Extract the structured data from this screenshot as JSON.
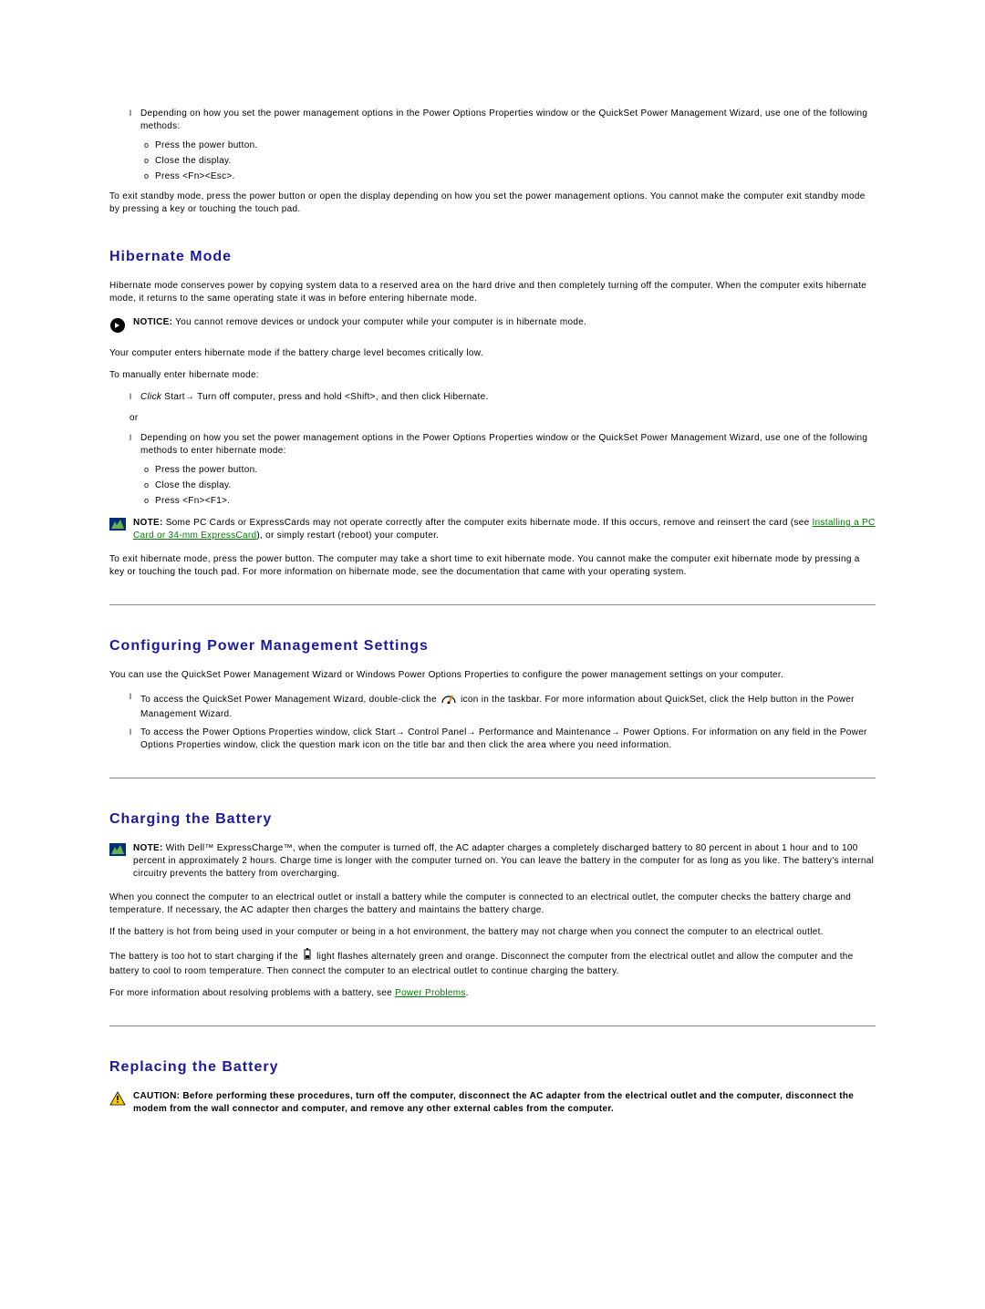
{
  "intro": {
    "li0": "Depending on how you set the power management options in the Power Options Properties window or the QuickSet Power Management Wizard, use one of the following methods:",
    "sub": [
      "Press the power button.",
      "Close the display.",
      "Press <Fn><Esc>."
    ],
    "exit": "To exit standby mode, press the power button or open the display depending on how you set the power management options. You cannot make the computer exit standby mode by pressing a key or touching the touch pad."
  },
  "hibernate": {
    "heading": "Hibernate Mode",
    "p1": "Hibernate mode conserves power by copying system data to a reserved area on the hard drive and then completely turning off the computer. When the computer exits hibernate mode, it returns to the same operating state it was in before entering hibernate mode.",
    "notice_label": "NOTICE:",
    "notice": "You cannot remove devices or undock your computer while your computer is in hibernate mode.",
    "p2": "Your computer enters hibernate mode if the battery charge level becomes critically low.",
    "p3": "To manually enter hibernate mode:",
    "li1_prefix": "Click",
    "li1_suffix": "Start→ Turn off computer, press and hold <Shift>, and then click Hibernate.",
    "or": "or",
    "li2": "Depending on how you set the power management options in the Power Options Properties window or the QuickSet Power Management Wizard, use one of the following methods to enter hibernate mode:",
    "sub": [
      "Press the power button.",
      "Close the display.",
      "Press <Fn><F1>."
    ],
    "note_label": "NOTE:",
    "note_a": "Some PC Cards or ExpressCards may not operate correctly after the computer exits hibernate mode. If this occurs, remove and reinsert the card (see ",
    "note_link": "Installing a PC Card or 34-mm ExpressCard",
    "note_b": "), or simply restart (reboot) your computer.",
    "p4": "To exit hibernate mode, press the power button. The computer may take a short time to exit hibernate mode. You cannot make the computer exit hibernate mode by pressing a key or touching the touch pad. For more information on hibernate mode, see the documentation that came with your operating system."
  },
  "config": {
    "heading": "Configuring Power Management Settings",
    "p1": "You can use the QuickSet Power Management Wizard or Windows Power Options Properties to configure the power management settings on your computer.",
    "li1a": "To access the QuickSet Power Management Wizard, double-click the ",
    "li1b": " icon in the taskbar. For more information about QuickSet, click the Help button in the Power Management Wizard.",
    "li2": "To access the Power Options Properties window, click Start→ Control Panel→ Performance and Maintenance→ Power Options. For information on any field in the Power Options Properties window, click the question mark icon on the title bar and then click the area where you need information."
  },
  "charging": {
    "heading": "Charging the Battery",
    "note_label": "NOTE:",
    "note": "With Dell™ ExpressCharge™, when the computer is turned off, the AC adapter charges a completely discharged battery to 80 percent in about 1 hour and to 100 percent in approximately 2 hours. Charge time is longer with the computer turned on. You can leave the battery in the computer for as long as you like. The battery's internal circuitry prevents the battery from overcharging.",
    "p1": "When you connect the computer to an electrical outlet or install a battery while the computer is connected to an electrical outlet, the computer checks the battery charge and temperature. If necessary, the AC adapter then charges the battery and maintains the battery charge.",
    "p2": "If the battery is hot from being used in your computer or being in a hot environment, the battery may not charge when you connect the computer to an electrical outlet.",
    "p3a": "The battery is too hot to start charging if the ",
    "p3b": " light flashes alternately green and orange. Disconnect the computer from the electrical outlet and allow the computer and the battery to cool to room temperature. Then connect the computer to an electrical outlet to continue charging the battery.",
    "p4a": "For more information about resolving problems with a battery, see ",
    "p4link": "Power Problems",
    "p4b": "."
  },
  "replacing": {
    "heading": "Replacing the Battery",
    "caution_label": "CAUTION:",
    "caution": "Before performing these procedures, turn off the computer, disconnect the AC adapter from the electrical outlet and the computer, disconnect the modem from the wall connector and computer, and remove any other external cables from the computer."
  }
}
